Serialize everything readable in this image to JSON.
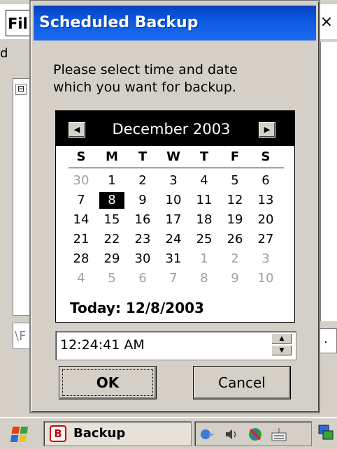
{
  "background_app": {
    "menu_label": "Fil",
    "side_text": "d",
    "close_label": "×",
    "tree_expander": "⊟",
    "field_text": "\\F",
    "right_button": "."
  },
  "dialog": {
    "title": "Scheduled Backup",
    "prompt_line1": "Please select time and date",
    "prompt_line2": "which you want for backup."
  },
  "calendar": {
    "prev_icon": "◀",
    "next_icon": "▶",
    "month_year": "December 2003",
    "weekdays": [
      "S",
      "M",
      "T",
      "W",
      "T",
      "F",
      "S"
    ],
    "weeks": [
      [
        "30",
        "1",
        "2",
        "3",
        "4",
        "5",
        "6"
      ],
      [
        "7",
        "8",
        "9",
        "10",
        "11",
        "12",
        "13"
      ],
      [
        "14",
        "15",
        "16",
        "17",
        "18",
        "19",
        "20"
      ],
      [
        "21",
        "22",
        "23",
        "24",
        "25",
        "26",
        "27"
      ],
      [
        "28",
        "29",
        "30",
        "31",
        "1",
        "2",
        "3"
      ],
      [
        "4",
        "5",
        "6",
        "7",
        "8",
        "9",
        "10"
      ]
    ],
    "selected_day": "8",
    "today_label": "Today: 12/8/2003"
  },
  "time": {
    "value": "12:24:41 AM",
    "up_icon": "▲",
    "down_icon": "▼"
  },
  "buttons": {
    "ok": "OK",
    "cancel": "Cancel"
  },
  "taskbar": {
    "task_label": "Backup",
    "task_icon_letter": "B"
  },
  "colors": {
    "title_bar": "#0b59e0",
    "calendar_header": "#000000",
    "selected_day_bg": "#000000",
    "other_month_text": "#a0a0a0"
  }
}
